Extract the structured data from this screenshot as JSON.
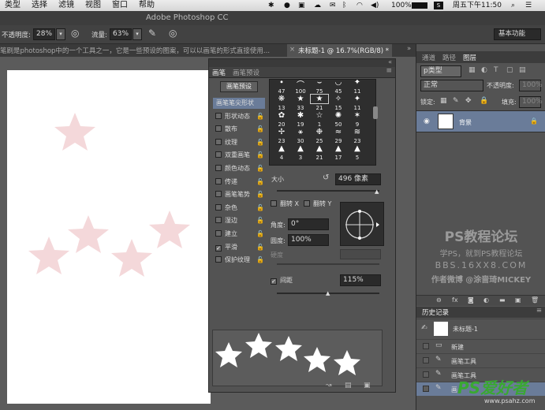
{
  "menubar": {
    "items": [
      "类型",
      "选择",
      "滤镜",
      "视图",
      "窗口",
      "帮助"
    ],
    "battery": "100%",
    "clock": "周五下午11:50"
  },
  "titlebar": {
    "title": "Adobe Photoshop CC"
  },
  "options": {
    "opacity_label": "不透明度:",
    "opacity_value": "28%",
    "flow_label": "流量:",
    "flow_value": "63%",
    "workspace": "基本功能"
  },
  "doc": {
    "hint_text": "笔刷是photoshop中的一个工具之一，它是一些预设的图案，可以以画笔的形式直接使用...",
    "tab_label": "未标题-1 @ 16.7%(RGB/8) *"
  },
  "brush_panel": {
    "tab_brush": "画笔",
    "tab_preset": "画笔预设",
    "preset_button": "画笔预设",
    "options": [
      {
        "label": "画笔笔尖形状",
        "checkable": false,
        "checked": false,
        "lock": false,
        "selected": true
      },
      {
        "label": "形状动态",
        "checkable": true,
        "checked": false,
        "lock": true
      },
      {
        "label": "散布",
        "checkable": true,
        "checked": false,
        "lock": true
      },
      {
        "label": "纹理",
        "checkable": true,
        "checked": false,
        "lock": true
      },
      {
        "label": "双重画笔",
        "checkable": true,
        "checked": false,
        "lock": true
      },
      {
        "label": "颜色动态",
        "checkable": true,
        "checked": false,
        "lock": true
      },
      {
        "label": "传递",
        "checkable": true,
        "checked": false,
        "lock": true
      },
      {
        "label": "画笔笔势",
        "checkable": true,
        "checked": false,
        "lock": true
      },
      {
        "label": "杂色",
        "checkable": true,
        "checked": false,
        "lock": true
      },
      {
        "label": "湿边",
        "checkable": true,
        "checked": false,
        "lock": true
      },
      {
        "label": "建立",
        "checkable": true,
        "checked": false,
        "lock": true
      },
      {
        "label": "平滑",
        "checkable": true,
        "checked": true,
        "lock": true
      },
      {
        "label": "保护纹理",
        "checkable": true,
        "checked": false,
        "lock": true
      }
    ],
    "tip_sizes": [
      [
        "47",
        "100",
        "75",
        "45",
        "11"
      ],
      [
        "13",
        "33",
        "21",
        "15",
        "11"
      ],
      [
        "20",
        "19",
        "1",
        "50",
        "9"
      ],
      [
        "23",
        "30",
        "25",
        "29",
        "23"
      ],
      [
        "4",
        "3",
        "21",
        "17",
        "5"
      ]
    ],
    "tip_glyphs": [
      [
        "∙",
        "⌒",
        "⌣",
        "◡",
        "✦"
      ],
      [
        "❋",
        "★",
        "★",
        "✧",
        "✦"
      ],
      [
        "✿",
        "✱",
        "☆",
        "✺",
        "✶"
      ],
      [
        "✢",
        "⚹",
        "❉",
        "≈",
        "≋"
      ],
      [
        "▲",
        "▲",
        "▲",
        "▲",
        "▲"
      ]
    ],
    "size_label": "大小",
    "size_value": "496 像素",
    "flip_x_label": "翻转 X",
    "flip_y_label": "翻转 Y",
    "angle_label": "角度:",
    "angle_value": "0°",
    "roundness_label": "圆度:",
    "roundness_value": "100%",
    "hardness_label": "硬度",
    "spacing_label": "间距",
    "spacing_value": "115%"
  },
  "right_panel": {
    "tabs": [
      "通道",
      "路径",
      "图层"
    ],
    "kind_label": "p类型",
    "blend_mode": "正常",
    "opacity_label": "不透明度:",
    "opacity_value": "100%",
    "lock_label": "锁定:",
    "fill_label": "填充:",
    "fill_value": "100%",
    "layer_name": "背景",
    "watermark": {
      "title": "PS教程论坛",
      "line2": "学PS，就到PS教程论坛",
      "line3": "BBS.16XX8.COM",
      "line4": "作者微博 @涂啬琦MICKEY"
    },
    "history_title": "历史记录",
    "history_snapshot": "未标题-1",
    "history_items": [
      "新建",
      "画笔工具",
      "画笔工具",
      "画"
    ],
    "logo_text": "PS爱好者",
    "logo_url": "www.psahz.com"
  }
}
